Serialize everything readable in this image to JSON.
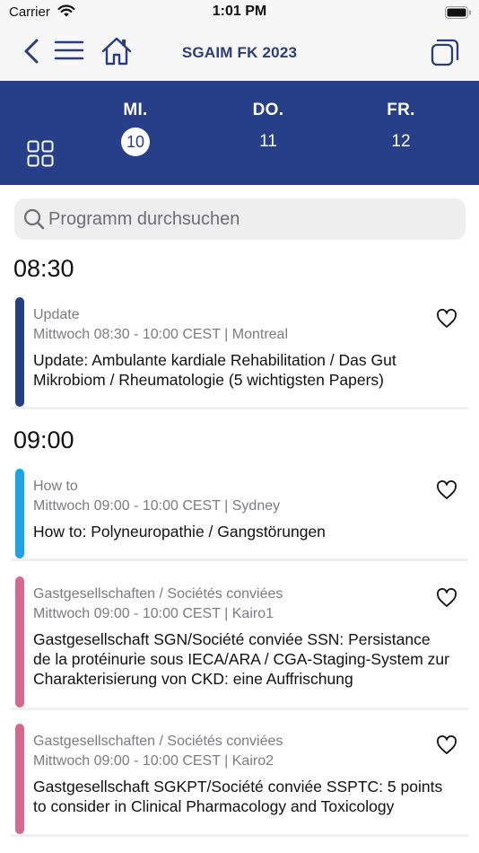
{
  "status_bar": {
    "carrier": "Carrier",
    "time": "1:01 PM"
  },
  "header": {
    "title": "SGAIM FK 2023"
  },
  "days": [
    {
      "name": "MI.",
      "num": "10",
      "selected": true
    },
    {
      "name": "DO.",
      "num": "11",
      "selected": false
    },
    {
      "name": "FR.",
      "num": "12",
      "selected": false
    }
  ],
  "search": {
    "placeholder": "Programm durchsuchen"
  },
  "time_groups": [
    {
      "time": "08:30",
      "sessions": [
        {
          "category": "Update",
          "meta": "Mittwoch 08:30 - 10:00 CEST | Montreal",
          "title": "Update: Ambulante kardiale Rehabilitation / Das Gut Mikrobiom / Rheumatologie (5 wichtigsten Papers)"
        }
      ]
    },
    {
      "time": "09:00",
      "sessions": [
        {
          "category": "How to",
          "meta": "Mittwoch 09:00 - 10:00 CEST | Sydney",
          "title": "How to: Polyneuropathie / Gangstörungen"
        },
        {
          "category": "Gastgesellschaften / Sociétés conviées",
          "meta": "Mittwoch 09:00 - 10:00 CEST | Kairo1",
          "title": "Gastgesellschaft SGN/Société conviée SSN: Persistance de la protéinurie sous IECA/ARA / CGA-Staging-System zur Charakterisierung von CKD: eine Auffrischung"
        },
        {
          "category": "Gastgesellschaften / Sociétés conviées",
          "meta": "Mittwoch 09:00 - 10:00 CEST | Kairo2",
          "title": "Gastgesellschaft SGKPT/Société conviée SSPTC: 5 points to consider in Clinical Pharmacology and Toxicology"
        }
      ]
    }
  ],
  "colors": {
    "brand": "#263f88",
    "header_title": "#2b3d7e",
    "update_bar": "#243f85",
    "howto_bar": "#1aa3e8",
    "guest_bar": "#d6678f"
  },
  "icons": [
    "wifi-icon",
    "battery-icon",
    "back-icon",
    "menu-icon",
    "home-icon",
    "copy-icon",
    "grid-icon",
    "search-icon",
    "heart-icon"
  ]
}
